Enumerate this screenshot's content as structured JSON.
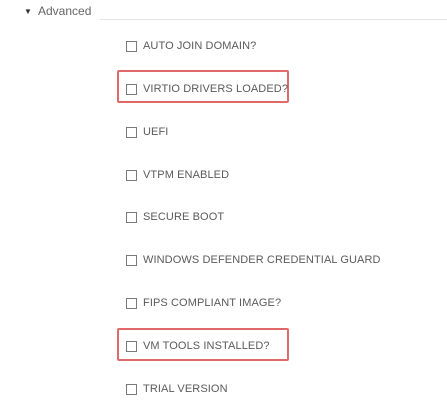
{
  "section": {
    "caret": "▼",
    "title": "Advanced"
  },
  "options": [
    {
      "label": "AUTO JOIN DOMAIN?",
      "checked": false
    },
    {
      "label": "VIRTIO DRIVERS LOADED?",
      "checked": false,
      "highlighted": true
    },
    {
      "label": "UEFI",
      "checked": false
    },
    {
      "label": "VTPM ENABLED",
      "checked": false
    },
    {
      "label": "SECURE BOOT",
      "checked": false
    },
    {
      "label": "WINDOWS DEFENDER CREDENTIAL GUARD",
      "checked": false
    },
    {
      "label": "FIPS COMPLIANT IMAGE?",
      "checked": false
    },
    {
      "label": "VM TOOLS INSTALLED?",
      "checked": false,
      "highlighted": true
    },
    {
      "label": "TRIAL VERSION",
      "checked": false
    }
  ],
  "colors": {
    "highlight": "#e06a6a",
    "text": "#5a5a5a",
    "checkbox_border": "#7a7a7a"
  }
}
